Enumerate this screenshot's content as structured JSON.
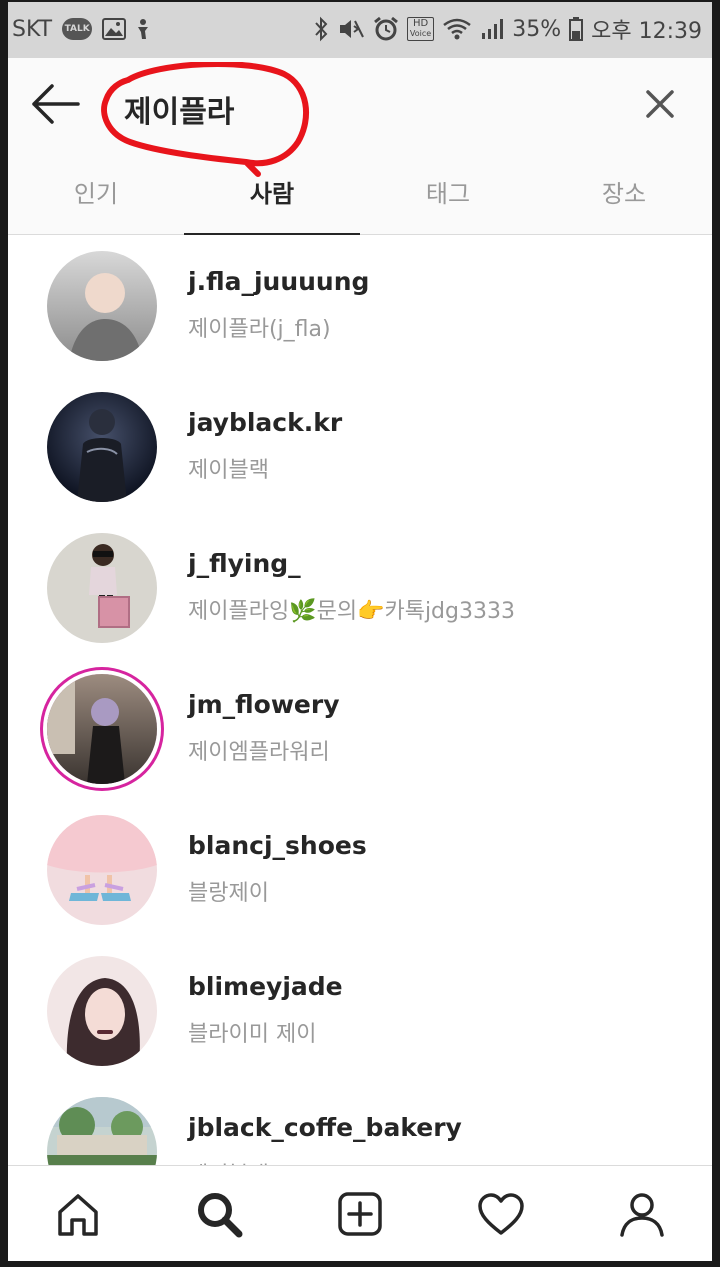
{
  "status_bar": {
    "carrier": "SKT",
    "talk_badge": "TALK",
    "hd_badge_top": "HD",
    "hd_badge_bottom": "Voice",
    "battery": "35%",
    "time": "오후 12:39"
  },
  "search": {
    "query": "제이플라",
    "annotation_color": "#e8141b"
  },
  "tabs": [
    {
      "label": "인기",
      "active": false
    },
    {
      "label": "사람",
      "active": true
    },
    {
      "label": "태그",
      "active": false
    },
    {
      "label": "장소",
      "active": false
    }
  ],
  "results": [
    {
      "username": "j.fla_juuuung",
      "full_name": "제이플라(j_fla)",
      "avatar_colors": [
        "#cfcfcf",
        "#8c8c8c"
      ],
      "story_ring": false
    },
    {
      "username": "jayblack.kr",
      "full_name": "제이블랙",
      "avatar_colors": [
        "#39425a",
        "#0d1220"
      ],
      "story_ring": false
    },
    {
      "username": "j_flying_",
      "full_name": "제이플라잉🌿문의👉카톡jdg3333",
      "avatar_colors": [
        "#d8d6cf",
        "#c79aa8"
      ],
      "story_ring": false
    },
    {
      "username": "jm_flowery",
      "full_name": "제이엠플라워리",
      "avatar_colors": [
        "#8f7e74",
        "#2b2724"
      ],
      "story_ring": true
    },
    {
      "username": "blancj_shoes",
      "full_name": "블랑제이",
      "avatar_colors": [
        "#f1d8dc",
        "#7fb9d6"
      ],
      "story_ring": false
    },
    {
      "username": "blimeyjade",
      "full_name": "블라이미 제이",
      "avatar_colors": [
        "#f2dede",
        "#6b4b4f"
      ],
      "story_ring": false
    },
    {
      "username": "jblack_coffe_bakery",
      "full_name": "제이블랙",
      "avatar_colors": [
        "#b8c7c2",
        "#4f7d4a"
      ],
      "story_ring": false
    }
  ],
  "bottom_nav": {
    "items": [
      "home-icon",
      "search-icon",
      "add-post-icon",
      "activity-heart-icon",
      "profile-icon"
    ]
  },
  "colors": {
    "text_primary": "#262626",
    "text_secondary": "#999999",
    "divider": "#dbdbdb",
    "status_bar_bg": "#d6d6d6"
  }
}
